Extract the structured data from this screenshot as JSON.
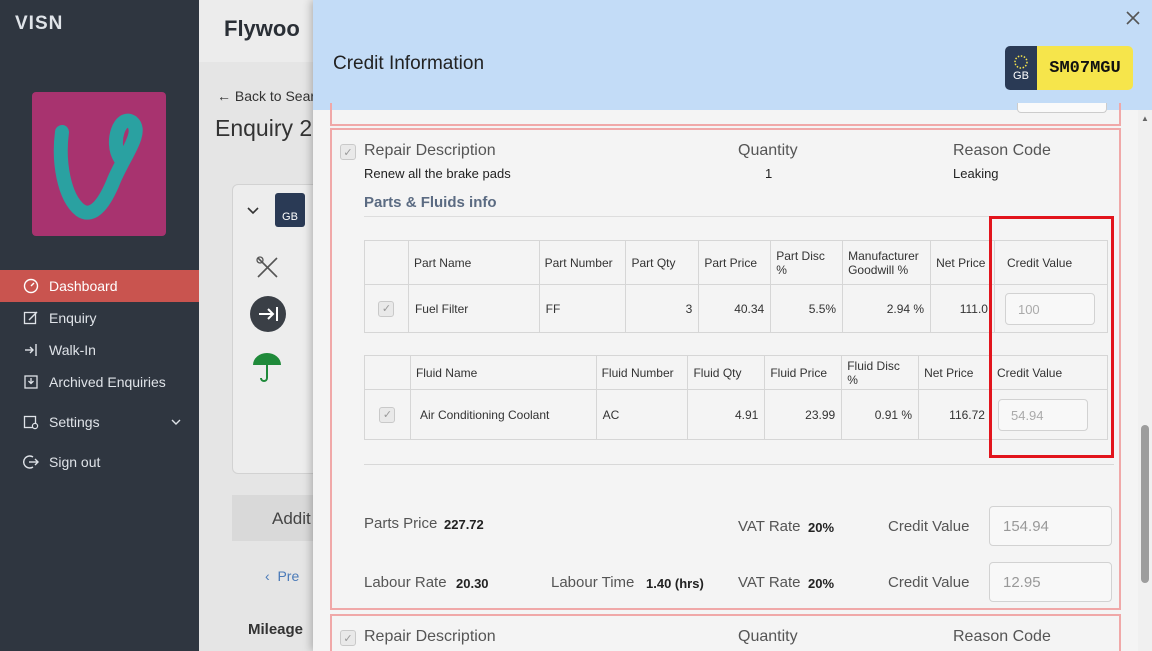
{
  "sidebar": {
    "brand": "VISN",
    "items": [
      {
        "label": "Dashboard",
        "icon": "gauge-icon"
      },
      {
        "label": "Enquiry",
        "icon": "edit-icon"
      },
      {
        "label": "Walk-In",
        "icon": "sign-in-icon"
      },
      {
        "label": "Archived Enquiries",
        "icon": "archive-icon"
      },
      {
        "label": "Settings",
        "icon": "settings-icon"
      },
      {
        "label": "Sign out",
        "icon": "sign-out-icon"
      }
    ],
    "active_index": 0
  },
  "background": {
    "title": "Flywoo",
    "back_link": "Back to Sear",
    "enquiry": "Enquiry 2",
    "additional": "Addit",
    "prev": "Pre",
    "mileage": "Mileage",
    "plate_gb": "GB"
  },
  "modal": {
    "title": "Credit Information",
    "plate": {
      "country": "GB",
      "reg": "SM07MGU"
    },
    "close_icon": "close-icon"
  },
  "repair": {
    "headers": {
      "description": "Repair Description",
      "quantity": "Quantity",
      "reason": "Reason Code"
    },
    "description": "Renew all the brake pads",
    "quantity": "1",
    "reason": "Leaking",
    "parts_fluids_title": "Parts & Fluids info",
    "parts_table": {
      "columns": [
        "Part Name",
        "Part Number",
        "Part Qty",
        "Part Price",
        "Part Disc %",
        "Manufacturer Goodwill %",
        "Net Price",
        "Credit Value"
      ],
      "rows": [
        {
          "name": "Fuel Filter",
          "number": "FF",
          "qty": "3",
          "price": "40.34",
          "disc": "5.5%",
          "goodwill": "2.94 %",
          "net": "111.0",
          "credit": "100"
        }
      ]
    },
    "fluids_table": {
      "columns": [
        "Fluid Name",
        "Fluid Number",
        "Fluid Qty",
        "Fluid Price",
        "Fluid Disc %",
        "Net Price",
        "Credit Value"
      ],
      "rows": [
        {
          "name": "Air Conditioning Coolant",
          "number": "AC",
          "qty": "4.91",
          "price": "23.99",
          "disc": "0.91 %",
          "net": "116.72",
          "credit": "54.94"
        }
      ]
    },
    "summary": {
      "parts_price_label": "Parts Price",
      "parts_price": "227.72",
      "vat_label": "VAT Rate",
      "vat": "20%",
      "credit_label": "Credit Value",
      "parts_credit": "154.94",
      "labour_rate_label": "Labour Rate",
      "labour_rate": "20.30",
      "labour_time_label": "Labour Time",
      "labour_time": "1.40 (hrs)",
      "labour_credit": "12.95"
    }
  },
  "next_repair": {
    "description": "Repair Description",
    "quantity": "Quantity",
    "reason": "Reason Code"
  },
  "colors": {
    "sidebar_bg": "#2f3640",
    "active_nav": "#c9544f",
    "modal_header": "#c3dcf7",
    "highlight": "#e2141c",
    "logo_bg": "#a8336f",
    "logo_letter": "#2aa1a1"
  }
}
